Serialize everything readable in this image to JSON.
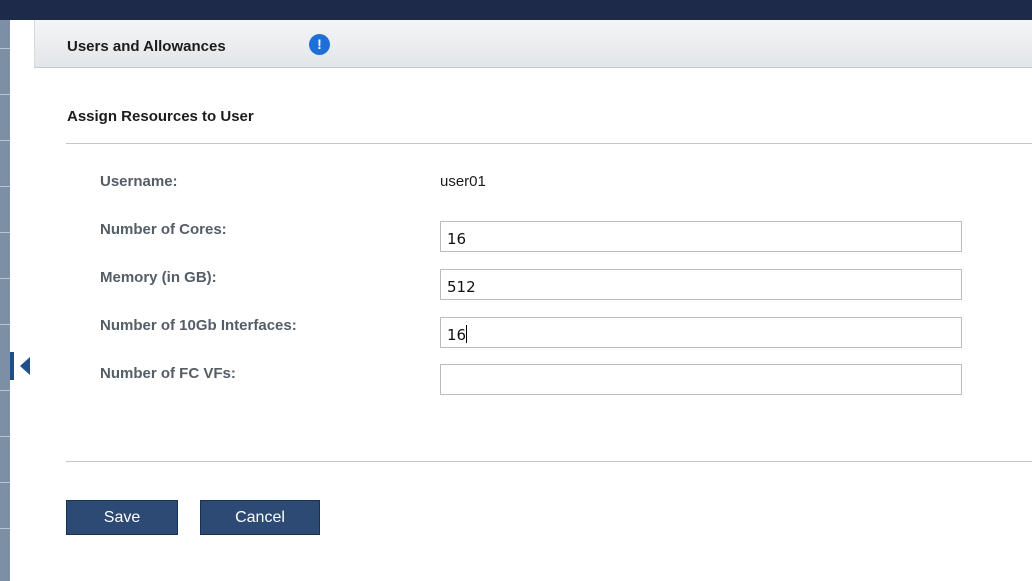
{
  "panel": {
    "title": "Users and Allowances",
    "info_icon_glyph": "!"
  },
  "form": {
    "section_title": "Assign Resources to User",
    "username": {
      "label": "Username:",
      "value": "user01"
    },
    "cores": {
      "label": "Number of Cores:",
      "value": "16"
    },
    "memory": {
      "label": "Memory (in GB):",
      "value": "512"
    },
    "interfaces": {
      "label": "Number of 10Gb Interfaces:",
      "value": "16"
    },
    "fc_vfs": {
      "label": "Number of FC VFs:",
      "value": ""
    }
  },
  "actions": {
    "save_label": "Save",
    "cancel_label": "Cancel"
  },
  "icons": {
    "info": "info-icon",
    "collapse": "collapse-arrow-icon"
  },
  "colors": {
    "top_bar": "#1e2a4a",
    "button_bg": "#2c4a74",
    "info_icon": "#1f6fd6",
    "label_text": "#555d66"
  }
}
